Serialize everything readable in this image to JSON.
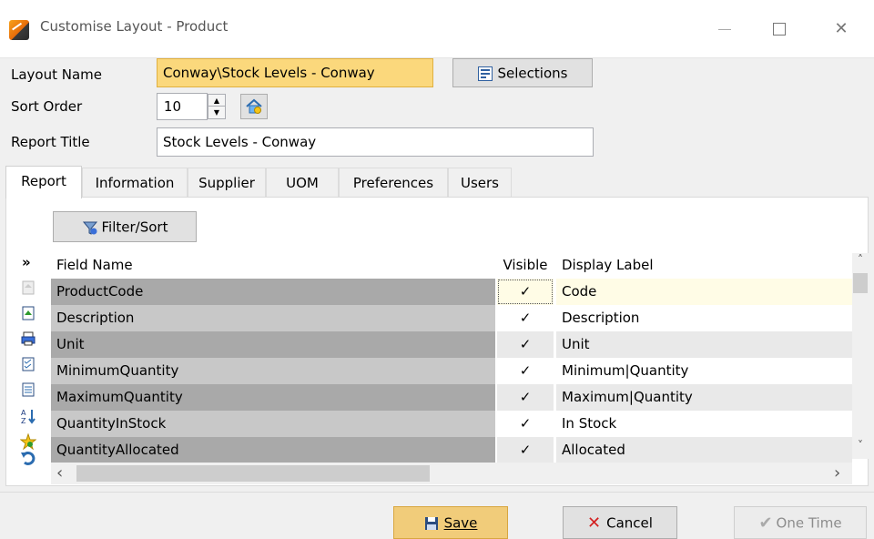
{
  "window": {
    "title": "Customise Layout - Product",
    "controls": {
      "minimize": "",
      "maximize": "",
      "close": "✕"
    }
  },
  "form": {
    "layout_name_label": "Layout Name",
    "layout_name_value": "Conway\\Stock Levels - Conway",
    "selections_button": "Selections",
    "sort_order_label": "Sort Order",
    "sort_order_value": "10",
    "report_title_label": "Report Title",
    "report_title_value": "Stock Levels - Conway"
  },
  "tabs": [
    {
      "label": "Report",
      "active": true
    },
    {
      "label": "Information"
    },
    {
      "label": "Supplier"
    },
    {
      "label": "UOM"
    },
    {
      "label": "Preferences"
    },
    {
      "label": "Users"
    }
  ],
  "report": {
    "filter_sort_button": "Filter/Sort",
    "expand_glyph": "»",
    "columns": {
      "field_name": "Field Name",
      "visible": "Visible",
      "display_label": "Display Label"
    },
    "rows": [
      {
        "field": "ProductCode",
        "visible": "✓",
        "label": "Code"
      },
      {
        "field": "Description",
        "visible": "✓",
        "label": "Description"
      },
      {
        "field": "Unit",
        "visible": "✓",
        "label": "Unit"
      },
      {
        "field": "MinimumQuantity",
        "visible": "✓",
        "label": "Minimum|Quantity"
      },
      {
        "field": "MaximumQuantity",
        "visible": "✓",
        "label": "Maximum|Quantity"
      },
      {
        "field": "QuantityInStock",
        "visible": "✓",
        "label": "In Stock"
      },
      {
        "field": "QuantityAllocated",
        "visible": "✓",
        "label": "Allocated"
      }
    ],
    "side_icons": [
      "move-up-icon",
      "import-icon",
      "print-icon",
      "checklist-icon",
      "list-icon",
      "sort-az-icon",
      "favourite-icon",
      "undo-icon"
    ],
    "scroll": {
      "left": "‹",
      "right": "›",
      "up": "˄",
      "down": "˅"
    }
  },
  "footer": {
    "save_button": "Save",
    "cancel_button": "Cancel",
    "one_time_button": "One Time"
  },
  "colors": {
    "selected_row": "#fffce6",
    "field_cell_dark": "#a9a9a9",
    "field_cell_light": "#c8c8c8",
    "save_button_bg": "#f1cc7a",
    "layout_name_bg": "#fbd87c",
    "cancel_icon": "#d32020"
  }
}
